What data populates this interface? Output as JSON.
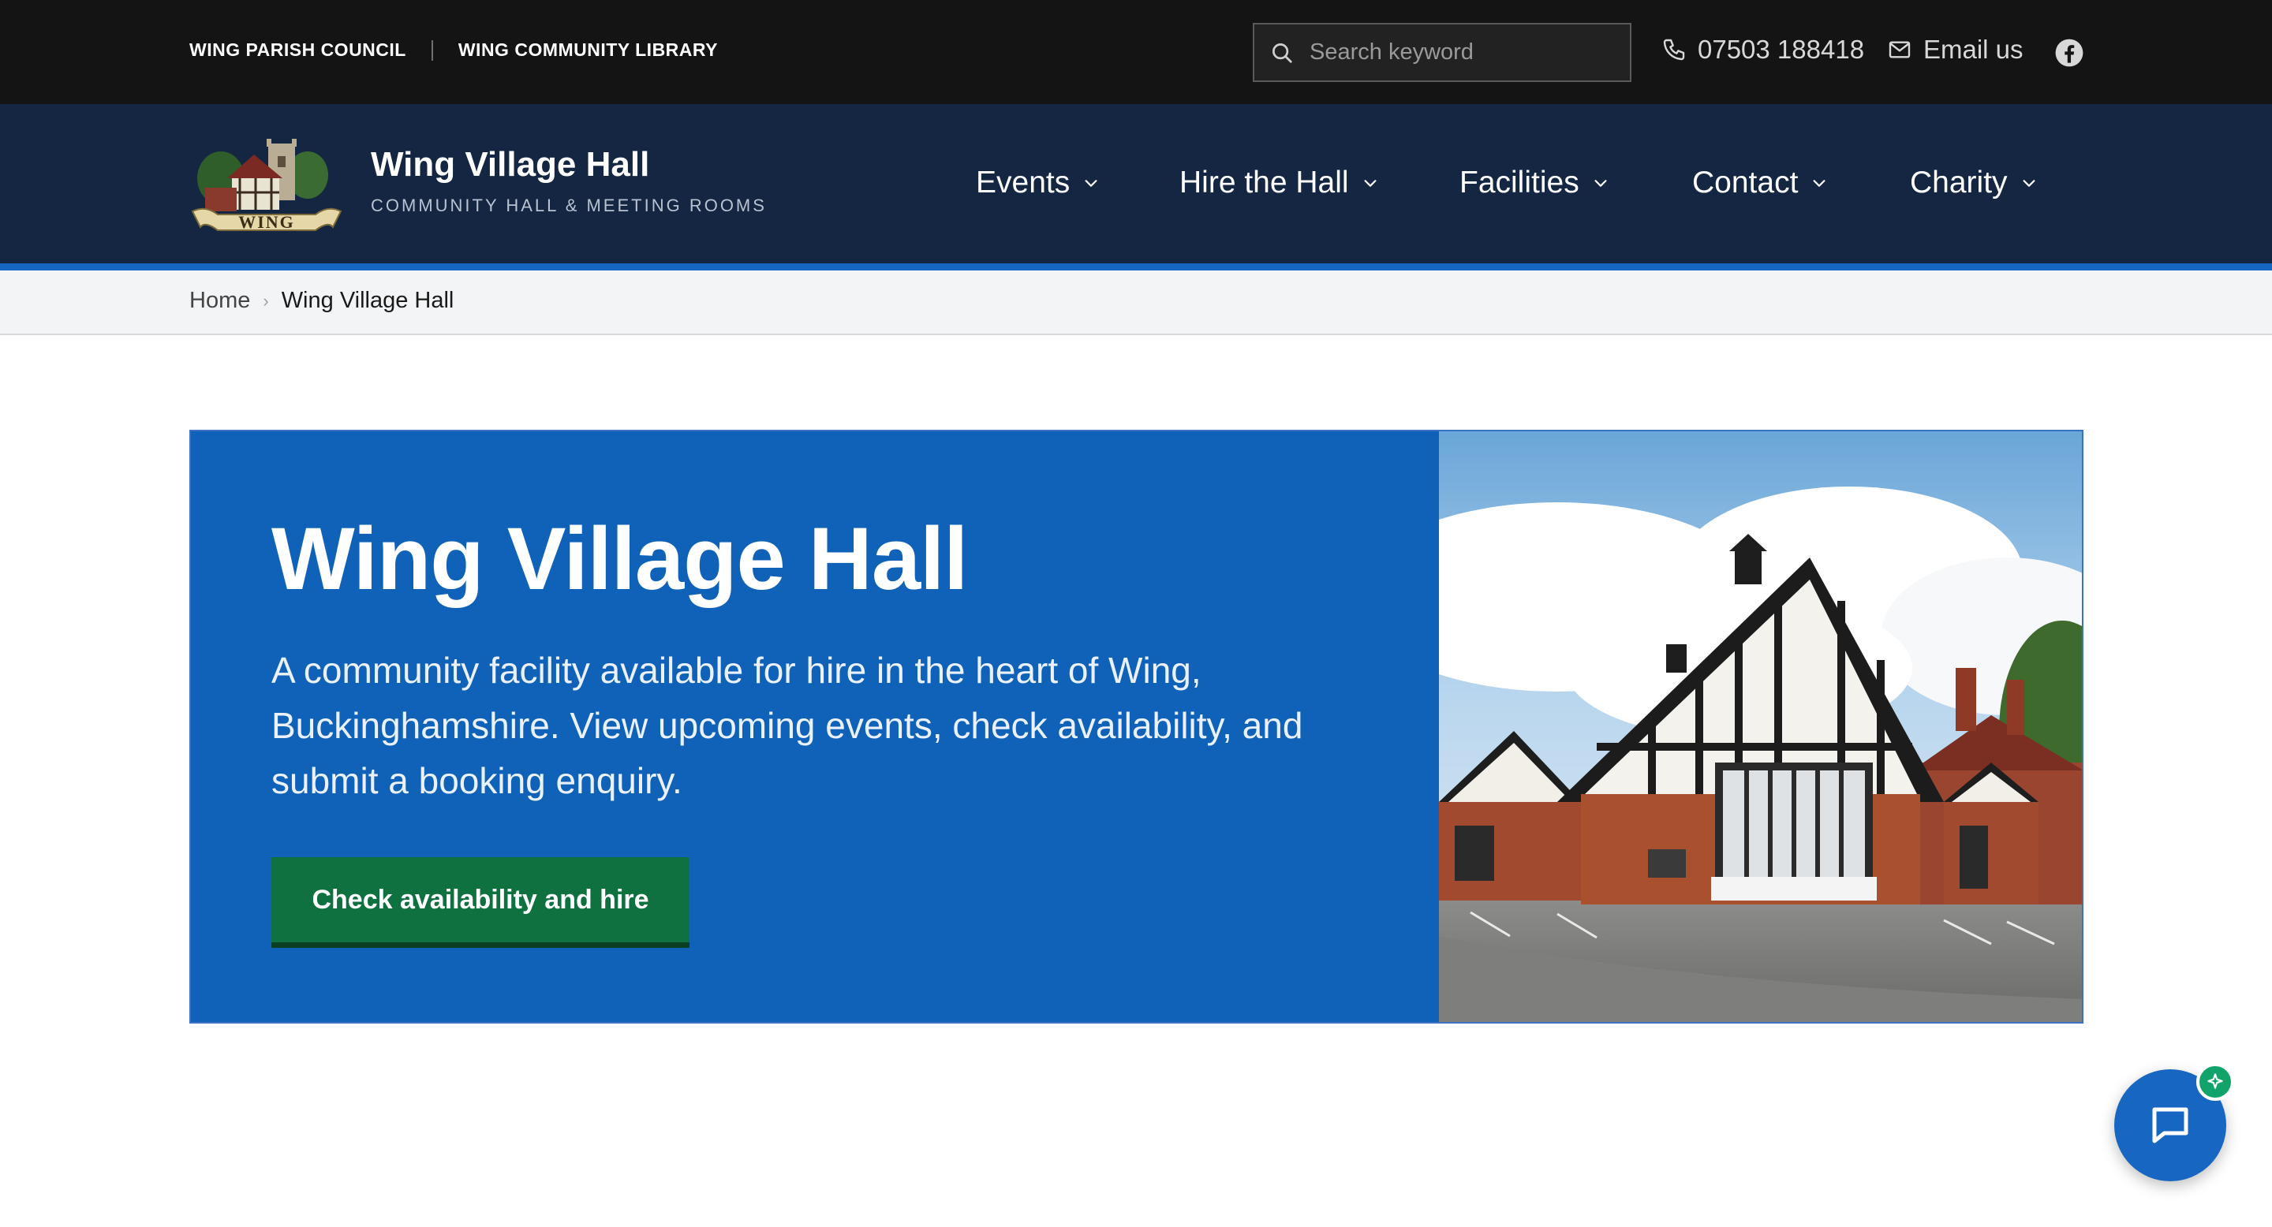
{
  "utility": {
    "links": [
      "WING PARISH COUNCIL",
      "WING COMMUNITY LIBRARY"
    ],
    "search_placeholder": "Search keyword",
    "phone": "07503 188418",
    "email_label": "Email us",
    "social_icon": "facebook-icon"
  },
  "header": {
    "title": "Wing Village Hall",
    "subtitle": "COMMUNITY HALL & MEETING ROOMS",
    "logo_text": "WING",
    "nav": [
      {
        "label": "Events"
      },
      {
        "label": "Hire the Hall"
      },
      {
        "label": "Facilities"
      },
      {
        "label": "Contact"
      },
      {
        "label": "Charity"
      }
    ]
  },
  "breadcrumb": {
    "home": "Home",
    "separator": "›",
    "current": "Wing Village Hall"
  },
  "hero": {
    "title": "Wing Village Hall",
    "description": "A community facility available for hire in the heart of Wing, Buckinghamshire. View upcoming events, check availability, and submit a booking enquiry.",
    "cta_label": "Check availability and hire"
  },
  "chat": {
    "icon": "chat-bubble-icon",
    "badge_icon": "sparkle-icon"
  },
  "colors": {
    "utility_bg": "#141414",
    "header_bg": "#142642",
    "accent": "#1766c2",
    "hero_bg": "#1062b8",
    "cta_bg": "#107140"
  }
}
